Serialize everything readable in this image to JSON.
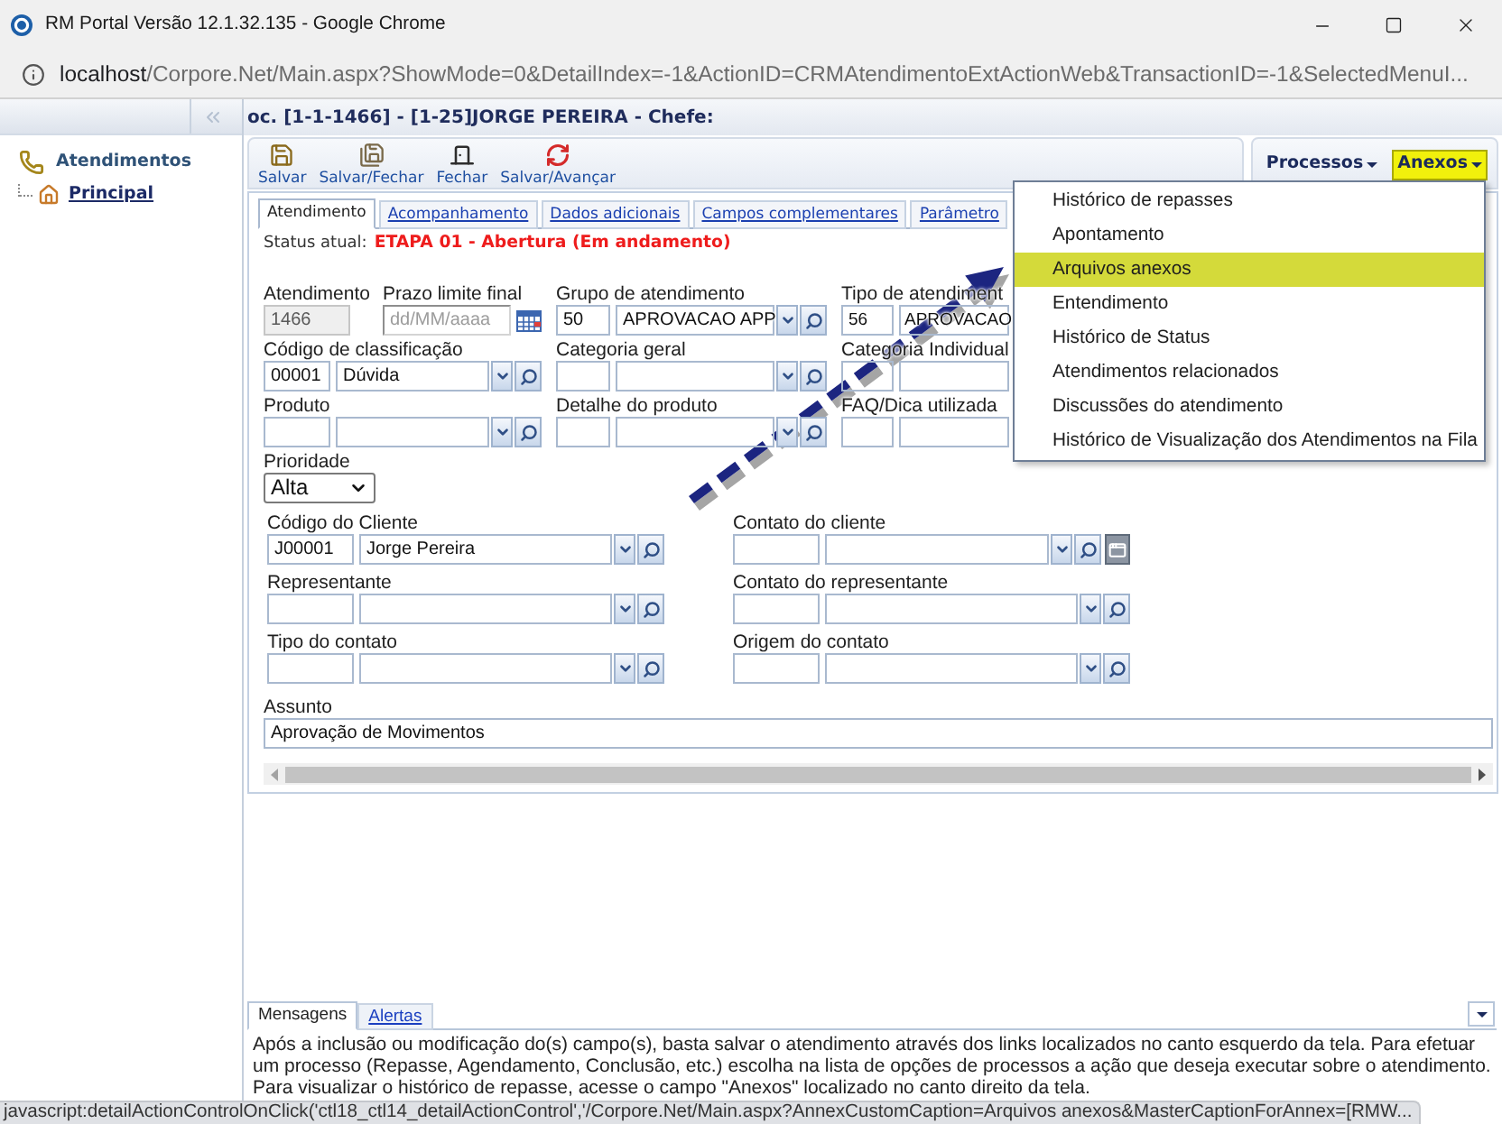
{
  "window": {
    "title": "RM Portal Versão 12.1.32.135 - Google Chrome"
  },
  "address_bar": {
    "host": "localhost",
    "path": "/Corpore.Net/Main.aspx?ShowMode=0&DetailIndex=-1&ActionID=CRMAtendimentoExtActionWeb&TransactionID=-1&SelectedMenuI..."
  },
  "sidebar": {
    "title": "Atendimentos",
    "items": [
      {
        "label": "Principal"
      }
    ]
  },
  "record_title": "oc. [1-1-1466] - [1-25]JORGE PEREIRA - Chefe:",
  "toolbar": {
    "actions": [
      {
        "kind": "save",
        "label": "Salvar"
      },
      {
        "kind": "saveclose",
        "label": "Salvar/Fechar"
      },
      {
        "kind": "close",
        "label": "Fechar"
      },
      {
        "kind": "advance",
        "label": "Salvar/Avançar"
      }
    ],
    "menus": [
      {
        "label": "Processos",
        "open": false
      },
      {
        "label": "Anexos",
        "open": true
      }
    ]
  },
  "dropdown_menu": {
    "items": [
      {
        "label": "Histórico de repasses",
        "selected": false
      },
      {
        "label": "Apontamento",
        "selected": false
      },
      {
        "label": "Arquivos anexos",
        "selected": true
      },
      {
        "label": "Entendimento",
        "selected": false
      },
      {
        "label": "Histórico de Status",
        "selected": false
      },
      {
        "label": "Atendimentos relacionados",
        "selected": false
      },
      {
        "label": "Discussões do atendimento",
        "selected": false
      },
      {
        "label": "Histórico de Visualização dos Atendimentos na Fila",
        "selected": false
      }
    ]
  },
  "tabs": [
    {
      "label": "Atendimento",
      "selected": true
    },
    {
      "label": "Acompanhamento",
      "selected": false
    },
    {
      "label": "Dados adicionais",
      "selected": false
    },
    {
      "label": "Campos complementares",
      "selected": false
    },
    {
      "label": "Parâmetro",
      "selected": false
    }
  ],
  "status": {
    "label": "Status atual:",
    "value": "ETAPA 01 - Abertura (Em andamento)"
  },
  "form": {
    "rows": [
      {
        "fields": [
          {
            "kind": "readonly",
            "label": "Atendimento",
            "value": "1466"
          },
          {
            "kind": "date",
            "label": "Prazo limite final",
            "placeholder": "dd/MM/aaaa"
          },
          {
            "kind": "lookup",
            "label": "Grupo de atendimento",
            "code": "50",
            "value": "APROVACAO APP"
          },
          {
            "kind": "partial",
            "label": "Tipo de atendiment",
            "code": "56",
            "value": "APROVACAO"
          }
        ]
      },
      {
        "fields": [
          {
            "kind": "lookup",
            "label": "Código de classificação",
            "code": "00001",
            "value": "Dúvida"
          },
          {
            "kind": "lookup",
            "label": "Categoria geral"
          },
          {
            "kind": "partial",
            "label": "Categoria Individual"
          }
        ]
      },
      {
        "fields": [
          {
            "kind": "lookup",
            "label": "Produto"
          },
          {
            "kind": "lookup",
            "label": "Detalhe do produto"
          },
          {
            "kind": "partial",
            "label": "FAQ/Dica utilizada"
          }
        ]
      },
      {
        "fields": [
          {
            "kind": "select",
            "label": "Prioridade",
            "value": "Alta"
          }
        ]
      }
    ],
    "contacts": [
      {
        "fields": [
          {
            "label": "Código do Cliente",
            "code": "J00001",
            "value": "Jorge Pereira",
            "popup": false
          },
          {
            "label": "Contato do cliente",
            "popup": true
          }
        ]
      },
      {
        "fields": [
          {
            "label": "Representante",
            "popup": false
          },
          {
            "label": "Contato do representante",
            "popup": false
          }
        ]
      },
      {
        "fields": [
          {
            "label": "Tipo do contato",
            "popup": false
          },
          {
            "label": "Origem do contato",
            "popup": false
          }
        ]
      }
    ],
    "subject": {
      "label": "Assunto",
      "value": "Aprovação de Movimentos"
    }
  },
  "messages": {
    "tabs": [
      {
        "label": "Mensagens",
        "selected": true
      },
      {
        "label": "Alertas",
        "selected": false
      }
    ],
    "text": "Após a inclusão ou modificação do(s) campo(s), basta salvar o atendimento através dos links localizados no canto esquerdo da tela. Para efetuar um processo (Repasse, Agendamento, Conclusão, etc.) escolha na lista de opções de processos a ação que deseja executar sobre o atendimento. Para visualizar o histórico de repasse, acesse o campo \"Anexos\" localizado no canto direito da tela."
  },
  "status_bar": {
    "text": "javascript:detailActionControlOnClick('ctl18_ctl14_detailActionControl','/Corpore.Net/Main.aspx?AnnexCustomCaption=Arquivos anexos&MasterCaptionForAnnex=[RMW..."
  }
}
